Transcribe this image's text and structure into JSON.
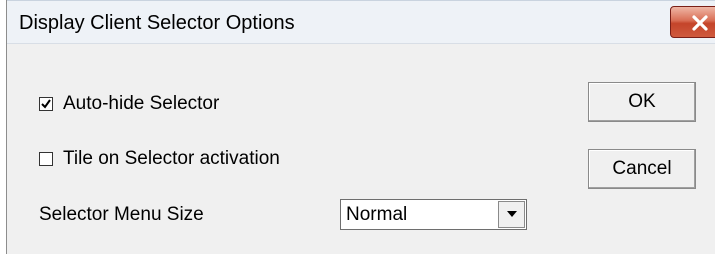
{
  "window": {
    "title": "Display Client Selector Options",
    "close_icon": "close-x-icon",
    "close_color": "#c4442a"
  },
  "options": {
    "auto_hide": {
      "label": "Auto-hide Selector",
      "checked": true
    },
    "tile_on_activation": {
      "label": "Tile on Selector activation",
      "checked": false
    }
  },
  "menu_size": {
    "label": "Selector Menu Size",
    "selected": "Normal",
    "arrow_icon": "chevron-down-icon"
  },
  "buttons": {
    "ok_label": "OK",
    "cancel_label": "Cancel"
  }
}
